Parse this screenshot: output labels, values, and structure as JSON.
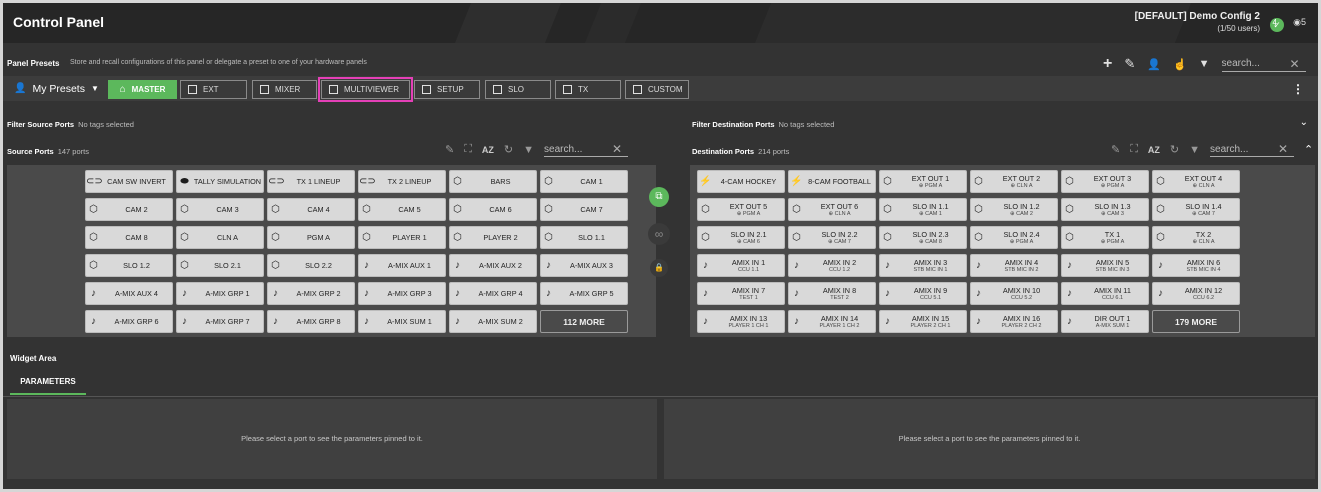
{
  "app": {
    "title": "Control Panel",
    "config_name": "[DEFAULT] Demo Config 2",
    "config_users": "(1/50 users)",
    "status_count": "4",
    "user_count": "5"
  },
  "presets": {
    "label": "Panel Presets",
    "description": "Store and recall configurations of this panel or delegate a preset to one of your hardware panels",
    "search_placeholder": "search...",
    "my_presets_label": "My Presets",
    "tags": [
      {
        "label": "MASTER",
        "active": true
      },
      {
        "label": "EXT"
      },
      {
        "label": "MIXER"
      },
      {
        "label": "MULTIVIEWER",
        "highlighted": true
      },
      {
        "label": "SETUP"
      },
      {
        "label": "SLO"
      },
      {
        "label": "TX"
      },
      {
        "label": "CUSTOM"
      }
    ]
  },
  "filters": {
    "source_label": "Filter Source Ports",
    "source_tags": "No tags selected",
    "dest_label": "Filter Destination Ports",
    "dest_tags": "No tags selected"
  },
  "source_ports": {
    "label": "Source Ports",
    "count": "147 ports",
    "search_placeholder": "search...",
    "more_label": "112 MORE",
    "items": [
      {
        "icon": "toggle",
        "name": "CAM SW INVERT"
      },
      {
        "icon": "toggle-on",
        "name": "TALLY SIMULATION"
      },
      {
        "icon": "toggle",
        "name": "TX 1 LINEUP"
      },
      {
        "icon": "toggle",
        "name": "TX 2 LINEUP"
      },
      {
        "icon": "cube",
        "name": "BARS"
      },
      {
        "icon": "cube",
        "name": "CAM 1"
      },
      {
        "icon": "cube",
        "name": "CAM 2"
      },
      {
        "icon": "cube",
        "name": "CAM 3"
      },
      {
        "icon": "cube",
        "name": "CAM 4"
      },
      {
        "icon": "cube",
        "name": "CAM 5"
      },
      {
        "icon": "cube",
        "name": "CAM 6"
      },
      {
        "icon": "cube",
        "name": "CAM 7"
      },
      {
        "icon": "cube",
        "name": "CAM 8"
      },
      {
        "icon": "cube",
        "name": "CLN A"
      },
      {
        "icon": "cube",
        "name": "PGM A"
      },
      {
        "icon": "cube",
        "name": "PLAYER 1"
      },
      {
        "icon": "cube",
        "name": "PLAYER 2"
      },
      {
        "icon": "cube",
        "name": "SLO 1.1"
      },
      {
        "icon": "cube",
        "name": "SLO 1.2"
      },
      {
        "icon": "cube",
        "name": "SLO 2.1"
      },
      {
        "icon": "cube",
        "name": "SLO 2.2"
      },
      {
        "icon": "note",
        "name": "A-MIX AUX 1"
      },
      {
        "icon": "note",
        "name": "A-MIX AUX 2"
      },
      {
        "icon": "note",
        "name": "A-MIX AUX 3"
      },
      {
        "icon": "note",
        "name": "A-MIX AUX 4"
      },
      {
        "icon": "note",
        "name": "A-MIX GRP 1"
      },
      {
        "icon": "note",
        "name": "A-MIX GRP 2"
      },
      {
        "icon": "note",
        "name": "A-MIX GRP 3"
      },
      {
        "icon": "note",
        "name": "A-MIX GRP 4"
      },
      {
        "icon": "note",
        "name": "A-MIX GRP 5"
      },
      {
        "icon": "note",
        "name": "A-MIX GRP 6"
      },
      {
        "icon": "note",
        "name": "A-MIX GRP 7"
      },
      {
        "icon": "note",
        "name": "A-MIX GRP 8"
      },
      {
        "icon": "note",
        "name": "A-MIX SUM 1"
      },
      {
        "icon": "note",
        "name": "A-MIX SUM 2"
      }
    ]
  },
  "dest_ports": {
    "label": "Destination Ports",
    "count": "214 ports",
    "search_placeholder": "search...",
    "more_label": "179 MORE",
    "items": [
      {
        "icon": "bolt",
        "name": "4-CAM HOCKEY",
        "sub": ""
      },
      {
        "icon": "bolt",
        "name": "8-CAM FOOTBALL",
        "sub": ""
      },
      {
        "icon": "cube",
        "name": "EXT OUT 1",
        "sub": "⊕ PGM A"
      },
      {
        "icon": "cube",
        "name": "EXT OUT 2",
        "sub": "⊕ CLN A"
      },
      {
        "icon": "cube",
        "name": "EXT OUT 3",
        "sub": "⊕ PGM A"
      },
      {
        "icon": "cube",
        "name": "EXT OUT 4",
        "sub": "⊕ CLN A"
      },
      {
        "icon": "cube",
        "name": "EXT OUT 5",
        "sub": "⊕ PGM A"
      },
      {
        "icon": "cube",
        "name": "EXT OUT 6",
        "sub": "⊕ CLN A"
      },
      {
        "icon": "cube",
        "name": "SLO IN 1.1",
        "sub": "⊕ CAM 1"
      },
      {
        "icon": "cube",
        "name": "SLO IN 1.2",
        "sub": "⊕ CAM 2"
      },
      {
        "icon": "cube",
        "name": "SLO IN 1.3",
        "sub": "⊕ CAM 3"
      },
      {
        "icon": "cube",
        "name": "SLO IN 1.4",
        "sub": "⊕ CAM 7"
      },
      {
        "icon": "cube",
        "name": "SLO IN 2.1",
        "sub": "⊕ CAM 6"
      },
      {
        "icon": "cube",
        "name": "SLO IN 2.2",
        "sub": "⊕ CAM 7"
      },
      {
        "icon": "cube",
        "name": "SLO IN 2.3",
        "sub": "⊕ CAM 8"
      },
      {
        "icon": "cube",
        "name": "SLO IN 2.4",
        "sub": "⊕ PGM A"
      },
      {
        "icon": "cube",
        "name": "TX 1",
        "sub": "⊕ PGM A"
      },
      {
        "icon": "cube",
        "name": "TX 2",
        "sub": "⊕ CLN A"
      },
      {
        "icon": "note",
        "name": "AMIX IN 1",
        "sub": "CCU 1.1"
      },
      {
        "icon": "note",
        "name": "AMIX IN 2",
        "sub": "CCU 1.2"
      },
      {
        "icon": "note",
        "name": "AMIX IN 3",
        "sub": "STB MIC IN 1"
      },
      {
        "icon": "note",
        "name": "AMIX IN 4",
        "sub": "STB MIC IN 2"
      },
      {
        "icon": "note",
        "name": "AMIX IN 5",
        "sub": "STB MIC IN 3"
      },
      {
        "icon": "note",
        "name": "AMIX IN 6",
        "sub": "STB MIC IN 4"
      },
      {
        "icon": "note",
        "name": "AMIX IN 7",
        "sub": "TEST 1"
      },
      {
        "icon": "note",
        "name": "AMIX IN 8",
        "sub": "TEST 2"
      },
      {
        "icon": "note",
        "name": "AMIX IN 9",
        "sub": "CCU 5.1"
      },
      {
        "icon": "note",
        "name": "AMIX IN 10",
        "sub": "CCU 5.2"
      },
      {
        "icon": "note",
        "name": "AMIX IN 11",
        "sub": "CCU 6.1"
      },
      {
        "icon": "note",
        "name": "AMIX IN 12",
        "sub": "CCU 6.2"
      },
      {
        "icon": "note",
        "name": "AMIX IN 13",
        "sub": "PLAYER 1 CH 1"
      },
      {
        "icon": "note",
        "name": "AMIX IN 14",
        "sub": "PLAYER 1 CH 2"
      },
      {
        "icon": "note",
        "name": "AMIX IN 15",
        "sub": "PLAYER 2 CH 1"
      },
      {
        "icon": "note",
        "name": "AMIX IN 16",
        "sub": "PLAYER 2 CH 2"
      },
      {
        "icon": "note",
        "name": "DIR OUT 1",
        "sub": "A-MIX SUM 1"
      }
    ]
  },
  "widget": {
    "label": "Widget Area",
    "tab_label": "PARAMETERS",
    "empty_message_left": "Please select a port to see the parameters pinned to it.",
    "empty_message_right": "Please select a port to see the parameters pinned to it."
  },
  "colors": {
    "accent": "#5cb85c",
    "highlight": "#e440b7"
  }
}
